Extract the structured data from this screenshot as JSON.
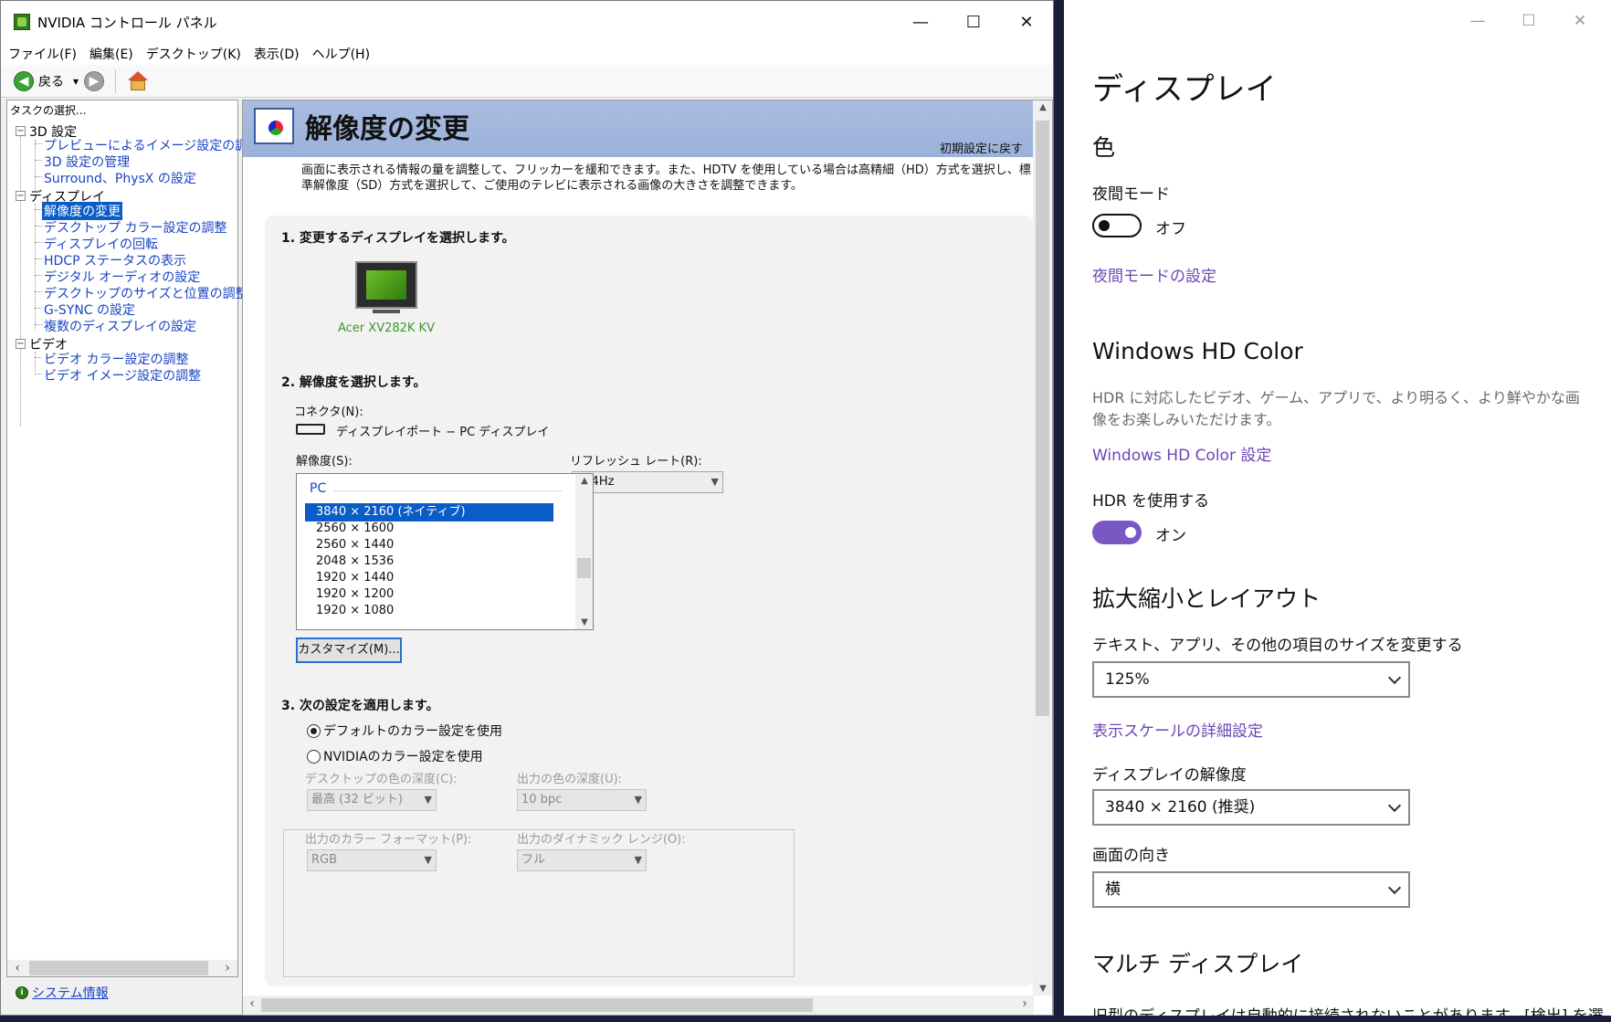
{
  "nvidia": {
    "title": "NVIDIA コントロール パネル",
    "caption": {
      "min": "—",
      "max": "☐",
      "close": "✕"
    },
    "menu": [
      "ファイル(F)",
      "編集(E)",
      "デスクトップ(K)",
      "表示(D)",
      "ヘルプ(H)"
    ],
    "toolbar": {
      "back_label": "戻る",
      "back_arrow": "◀",
      "forward_arrow": "▶",
      "dropdown": "▾"
    },
    "task_header": "タスクの選択...",
    "tree": {
      "cat_3d": "3D 設定",
      "item_preview": "プレビューによるイメージ設定の調整",
      "item_3dmanage": "3D 設定の管理",
      "item_surround": "Surround、PhysX の設定",
      "cat_display": "ディスプレイ",
      "item_resolution": "解像度の変更",
      "item_desktop_color": "デスクトップ カラー設定の調整",
      "item_rotate": "ディスプレイの回転",
      "item_hdcp": "HDCP ステータスの表示",
      "item_audio": "デジタル オーディオの設定",
      "item_size": "デスクトップのサイズと位置の調整",
      "item_gsync": "G-SYNC の設定",
      "item_multi": "複数のディスプレイの設定",
      "cat_video": "ビデオ",
      "item_video_color": "ビデオ カラー設定の調整",
      "item_video_image": "ビデオ イメージ設定の調整"
    },
    "sysinfo": "システム情報",
    "page_title": "解像度の変更",
    "restore_defaults": "初期設定に戻す",
    "description": "画面に表示される情報の量を調整して、フリッカーを緩和できます。また、HDTV を使用している場合は高精細（HD）方式を選択し、標準解像度（SD）方式を選択して、ご使用のテレビに表示される画像の大きさを調整できます。",
    "step1": "1. 変更するディスプレイを選択します。",
    "monitor_name": "Acer XV282K KV",
    "step2": "2. 解像度を選択します。",
    "connector_label": "コネクタ(N):",
    "connector_value": "ディスプレイポート − PC ディスプレイ",
    "resolution_label": "解像度(S):",
    "refresh_label": "リフレッシュ レート(R):",
    "refresh_value": "144Hz",
    "res_group": "PC",
    "resolutions": [
      "3840 × 2160 (ネイティブ)",
      "2560 × 1600",
      "2560 × 1440",
      "2048 × 1536",
      "1920 × 1440",
      "1920 × 1200",
      "1920 × 1080"
    ],
    "customize_button": "カスタマイズ(M)...",
    "step3": "3. 次の設定を適用します。",
    "radio_default": "デフォルトのカラー設定を使用",
    "radio_nvidia": "NVIDIAのカラー設定を使用",
    "desktop_depth_label": "デスクトップの色の深度(C):",
    "desktop_depth_value": "最高 (32 ビット)",
    "output_depth_label": "出力の色の深度(U):",
    "output_depth_value": "10 bpc",
    "output_format_label": "出力のカラー フォーマット(P):",
    "output_format_value": "RGB",
    "dynamic_range_label": "出力のダイナミック レンジ(O):",
    "dynamic_range_value": "フル"
  },
  "settings": {
    "caption": {
      "min": "—",
      "max": "☐",
      "close": "✕"
    },
    "title": "ディスプレイ",
    "color_heading": "色",
    "night_mode_label": "夜間モード",
    "night_mode_state": "オフ",
    "night_mode_link": "夜間モードの設定",
    "hd_color_heading": "Windows HD Color",
    "hd_color_desc": "HDR に対応したビデオ、ゲーム、アプリで、より明るく、より鮮やかな画像をお楽しみいただけます。",
    "hd_color_link": "Windows HD Color 設定",
    "hdr_label": "HDR を使用する",
    "hdr_state": "オン",
    "scale_heading": "拡大縮小とレイアウト",
    "scale_label": "テキスト、アプリ、その他の項目のサイズを変更する",
    "scale_value": "125%",
    "scale_link": "表示スケールの詳細設定",
    "resolution_label": "ディスプレイの解像度",
    "resolution_value": "3840 × 2160 (推奨)",
    "orientation_label": "画面の向き",
    "orientation_value": "横",
    "multi_heading": "マルチ ディスプレイ",
    "multi_desc": "旧型のディスプレイは自動的に接続されないことがあります。[検出] を選"
  },
  "colors": {
    "accent_purple": "#7b57c4",
    "link_blue": "#1a44c4",
    "nvidia_green": "#3a9a28",
    "selection": "#0a5cc7"
  }
}
